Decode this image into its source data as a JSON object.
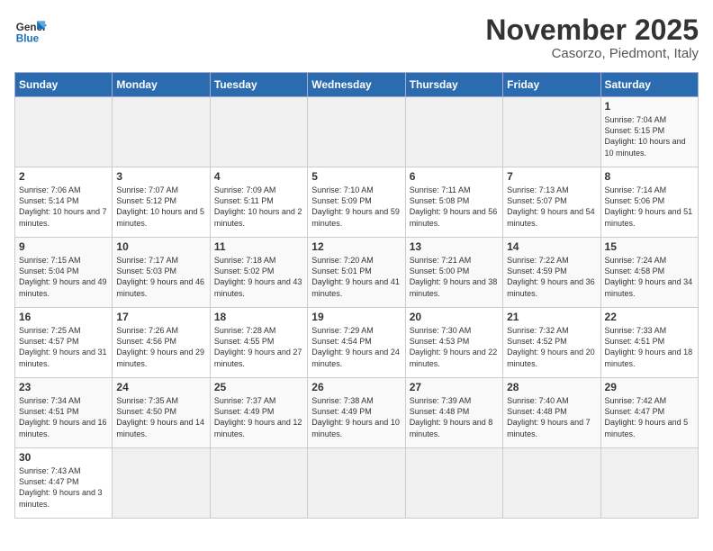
{
  "logo": {
    "line1": "General",
    "line2": "Blue"
  },
  "title": "November 2025",
  "subtitle": "Casorzo, Piedmont, Italy",
  "days_of_week": [
    "Sunday",
    "Monday",
    "Tuesday",
    "Wednesday",
    "Thursday",
    "Friday",
    "Saturday"
  ],
  "weeks": [
    [
      {
        "day": "",
        "info": ""
      },
      {
        "day": "",
        "info": ""
      },
      {
        "day": "",
        "info": ""
      },
      {
        "day": "",
        "info": ""
      },
      {
        "day": "",
        "info": ""
      },
      {
        "day": "",
        "info": ""
      },
      {
        "day": "1",
        "info": "Sunrise: 7:04 AM\nSunset: 5:15 PM\nDaylight: 10 hours and 10 minutes."
      }
    ],
    [
      {
        "day": "2",
        "info": "Sunrise: 7:06 AM\nSunset: 5:14 PM\nDaylight: 10 hours and 7 minutes."
      },
      {
        "day": "3",
        "info": "Sunrise: 7:07 AM\nSunset: 5:12 PM\nDaylight: 10 hours and 5 minutes."
      },
      {
        "day": "4",
        "info": "Sunrise: 7:09 AM\nSunset: 5:11 PM\nDaylight: 10 hours and 2 minutes."
      },
      {
        "day": "5",
        "info": "Sunrise: 7:10 AM\nSunset: 5:09 PM\nDaylight: 9 hours and 59 minutes."
      },
      {
        "day": "6",
        "info": "Sunrise: 7:11 AM\nSunset: 5:08 PM\nDaylight: 9 hours and 56 minutes."
      },
      {
        "day": "7",
        "info": "Sunrise: 7:13 AM\nSunset: 5:07 PM\nDaylight: 9 hours and 54 minutes."
      },
      {
        "day": "8",
        "info": "Sunrise: 7:14 AM\nSunset: 5:06 PM\nDaylight: 9 hours and 51 minutes."
      }
    ],
    [
      {
        "day": "9",
        "info": "Sunrise: 7:15 AM\nSunset: 5:04 PM\nDaylight: 9 hours and 49 minutes."
      },
      {
        "day": "10",
        "info": "Sunrise: 7:17 AM\nSunset: 5:03 PM\nDaylight: 9 hours and 46 minutes."
      },
      {
        "day": "11",
        "info": "Sunrise: 7:18 AM\nSunset: 5:02 PM\nDaylight: 9 hours and 43 minutes."
      },
      {
        "day": "12",
        "info": "Sunrise: 7:20 AM\nSunset: 5:01 PM\nDaylight: 9 hours and 41 minutes."
      },
      {
        "day": "13",
        "info": "Sunrise: 7:21 AM\nSunset: 5:00 PM\nDaylight: 9 hours and 38 minutes."
      },
      {
        "day": "14",
        "info": "Sunrise: 7:22 AM\nSunset: 4:59 PM\nDaylight: 9 hours and 36 minutes."
      },
      {
        "day": "15",
        "info": "Sunrise: 7:24 AM\nSunset: 4:58 PM\nDaylight: 9 hours and 34 minutes."
      }
    ],
    [
      {
        "day": "16",
        "info": "Sunrise: 7:25 AM\nSunset: 4:57 PM\nDaylight: 9 hours and 31 minutes."
      },
      {
        "day": "17",
        "info": "Sunrise: 7:26 AM\nSunset: 4:56 PM\nDaylight: 9 hours and 29 minutes."
      },
      {
        "day": "18",
        "info": "Sunrise: 7:28 AM\nSunset: 4:55 PM\nDaylight: 9 hours and 27 minutes."
      },
      {
        "day": "19",
        "info": "Sunrise: 7:29 AM\nSunset: 4:54 PM\nDaylight: 9 hours and 24 minutes."
      },
      {
        "day": "20",
        "info": "Sunrise: 7:30 AM\nSunset: 4:53 PM\nDaylight: 9 hours and 22 minutes."
      },
      {
        "day": "21",
        "info": "Sunrise: 7:32 AM\nSunset: 4:52 PM\nDaylight: 9 hours and 20 minutes."
      },
      {
        "day": "22",
        "info": "Sunrise: 7:33 AM\nSunset: 4:51 PM\nDaylight: 9 hours and 18 minutes."
      }
    ],
    [
      {
        "day": "23",
        "info": "Sunrise: 7:34 AM\nSunset: 4:51 PM\nDaylight: 9 hours and 16 minutes."
      },
      {
        "day": "24",
        "info": "Sunrise: 7:35 AM\nSunset: 4:50 PM\nDaylight: 9 hours and 14 minutes."
      },
      {
        "day": "25",
        "info": "Sunrise: 7:37 AM\nSunset: 4:49 PM\nDaylight: 9 hours and 12 minutes."
      },
      {
        "day": "26",
        "info": "Sunrise: 7:38 AM\nSunset: 4:49 PM\nDaylight: 9 hours and 10 minutes."
      },
      {
        "day": "27",
        "info": "Sunrise: 7:39 AM\nSunset: 4:48 PM\nDaylight: 9 hours and 8 minutes."
      },
      {
        "day": "28",
        "info": "Sunrise: 7:40 AM\nSunset: 4:48 PM\nDaylight: 9 hours and 7 minutes."
      },
      {
        "day": "29",
        "info": "Sunrise: 7:42 AM\nSunset: 4:47 PM\nDaylight: 9 hours and 5 minutes."
      }
    ],
    [
      {
        "day": "30",
        "info": "Sunrise: 7:43 AM\nSunset: 4:47 PM\nDaylight: 9 hours and 3 minutes."
      },
      {
        "day": "",
        "info": ""
      },
      {
        "day": "",
        "info": ""
      },
      {
        "day": "",
        "info": ""
      },
      {
        "day": "",
        "info": ""
      },
      {
        "day": "",
        "info": ""
      },
      {
        "day": "",
        "info": ""
      }
    ]
  ]
}
